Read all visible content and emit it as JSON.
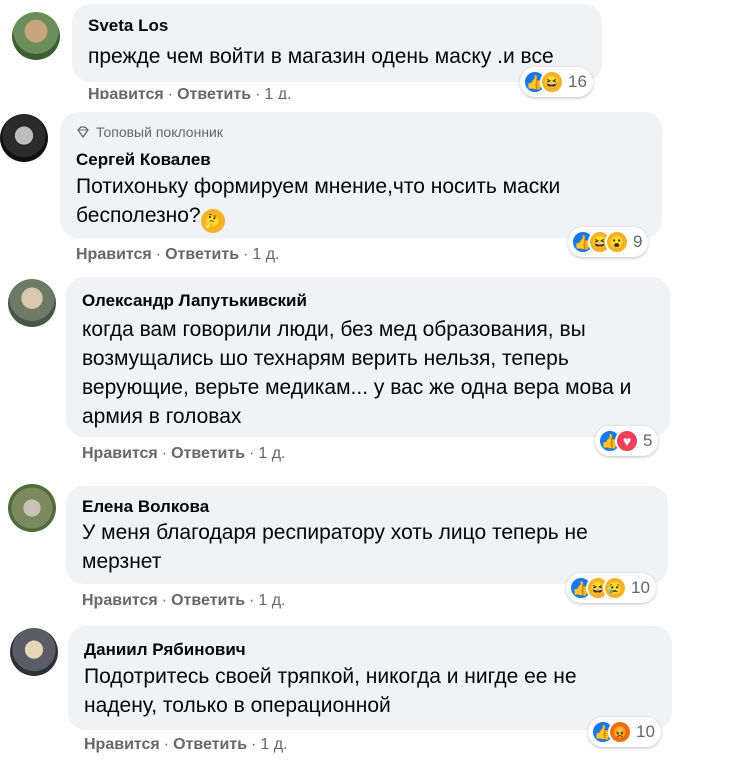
{
  "actions": {
    "like": "Нравится",
    "reply": "Ответить",
    "sep": "·"
  },
  "comments": [
    {
      "author": "Sveta Los",
      "text": "прежде чем войти в магазин одень маску .и все",
      "reactions": [
        "like",
        "haha"
      ],
      "count": "16",
      "time": "1 д."
    },
    {
      "badge": "Топовый поклонник",
      "author": "Сергей Ковалев",
      "text": "Потихоньку формируем мнение,что носить маски бесполезно?",
      "reactions": [
        "like",
        "haha",
        "wow"
      ],
      "count": "9",
      "time": "1 д."
    },
    {
      "author": "Олександр Лапутькивский",
      "text": "когда вам говорили люди, без мед образования, вы возмущались шо технарям верить нельзя, теперь верующие, верьте медикам... у вас же одна вера мова и армия в головах",
      "reactions": [
        "like",
        "love"
      ],
      "count": "5",
      "time": "1 д."
    },
    {
      "author": "Елена Волкова",
      "text": "У меня благодаря респиратору хоть лицо теперь не мерзнет",
      "reactions": [
        "like",
        "haha",
        "sad"
      ],
      "count": "10",
      "time": "1 д."
    },
    {
      "author": "Даниил Рябинович",
      "text": "Подотритесь своей тряпкой, никогда и нигде ее не надену, только в операционной",
      "reactions": [
        "like",
        "angry"
      ],
      "count": "10",
      "time": "1 д."
    }
  ],
  "colors": {
    "bubble": "#f0f2f5",
    "link": "#65676b",
    "like": "#1877f2"
  }
}
